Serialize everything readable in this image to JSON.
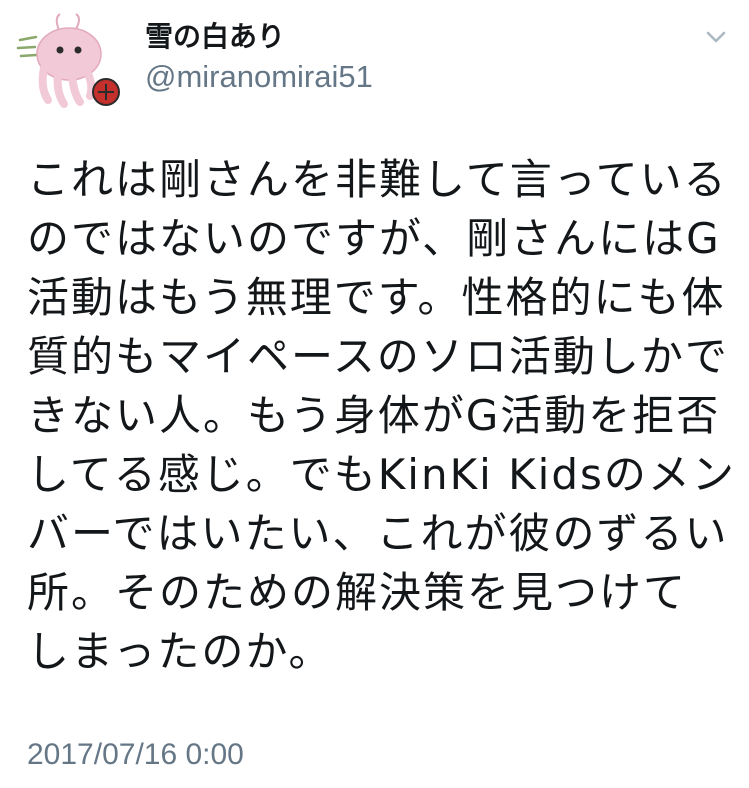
{
  "user": {
    "display_name": "雪の白あり",
    "handle": "@miranomirai51",
    "avatar_icon": "pink-octopus-avatar-icon"
  },
  "menu": {
    "caret_icon": "chevron-down-icon"
  },
  "tweet": {
    "lines": [
      "これは剛さんを非難して言っている",
      "のではないのですが、剛さんにはG",
      "活動はもう無理です。性格的にも体",
      "質的もマイペースのソロ活動しかで",
      "きない人。もう身体がG活動を拒否",
      "してる感じ。でもKinKi Kidsのメン",
      "バーではいたい、これが彼のずるい",
      "所。そのための解決策を見つけて",
      "しまったのか。"
    ],
    "timestamp": "2017/07/16 0:00"
  },
  "colors": {
    "text": "#14171a",
    "secondary": "#657786",
    "avatar_pink": "#f2c9d6",
    "badge_red": "#c4302b"
  }
}
